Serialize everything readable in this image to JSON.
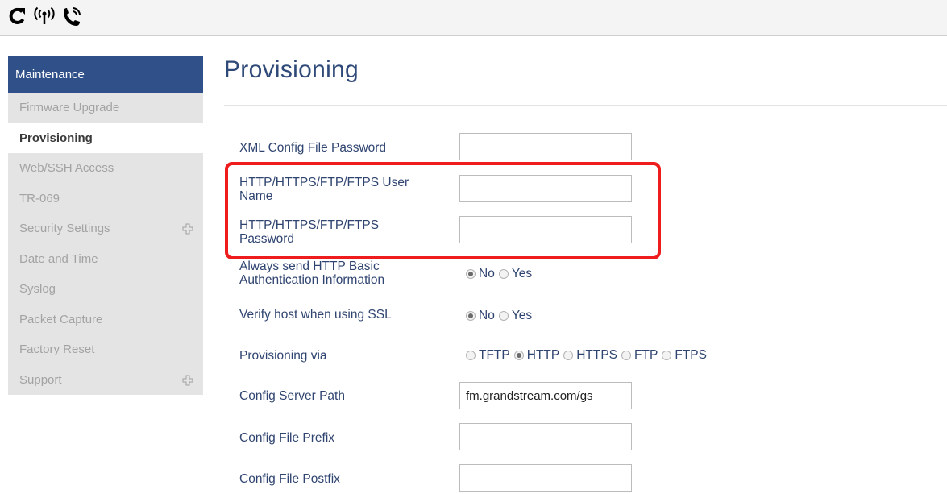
{
  "toolbar": {
    "icons": [
      "refresh-icon",
      "wireless-signal-icon",
      "phone-ringing-icon"
    ]
  },
  "sidebar": {
    "header": "Maintenance",
    "items": [
      {
        "label": "Firmware Upgrade",
        "active": false,
        "expandable": false
      },
      {
        "label": "Provisioning",
        "active": true,
        "expandable": false
      },
      {
        "label": "Web/SSH Access",
        "active": false,
        "expandable": false
      },
      {
        "label": "TR-069",
        "active": false,
        "expandable": false
      },
      {
        "label": "Security Settings",
        "active": false,
        "expandable": true
      },
      {
        "label": "Date and Time",
        "active": false,
        "expandable": false
      },
      {
        "label": "Syslog",
        "active": false,
        "expandable": false
      },
      {
        "label": "Packet Capture",
        "active": false,
        "expandable": false
      },
      {
        "label": "Factory Reset",
        "active": false,
        "expandable": false
      },
      {
        "label": "Support",
        "active": false,
        "expandable": true
      }
    ]
  },
  "page": {
    "title": "Provisioning"
  },
  "form": {
    "xml_password": {
      "label": "XML Config File Password",
      "value": ""
    },
    "http_username": {
      "label_line1": "HTTP/HTTPS/FTP/FTPS User",
      "label_line2": "Name",
      "value": ""
    },
    "http_password": {
      "label_line1": "HTTP/HTTPS/FTP/FTPS",
      "label_line2": "Password",
      "value": ""
    },
    "basic_auth": {
      "label_line1": "Always send HTTP Basic",
      "label_line2": "Authentication Information",
      "options": [
        "No",
        "Yes"
      ],
      "selected": "No"
    },
    "verify_ssl": {
      "label": "Verify host when using SSL",
      "options": [
        "No",
        "Yes"
      ],
      "selected": "No"
    },
    "provisioning_via": {
      "label": "Provisioning via",
      "options": [
        "TFTP",
        "HTTP",
        "HTTPS",
        "FTP",
        "FTPS"
      ],
      "selected": "HTTP"
    },
    "config_server_path": {
      "label": "Config Server Path",
      "value": "fm.grandstream.com/gs"
    },
    "config_file_prefix": {
      "label": "Config File Prefix",
      "value": ""
    },
    "config_file_postfix": {
      "label": "Config File Postfix",
      "value": ""
    }
  },
  "colors": {
    "sidebar_header_bg": "#2f5089",
    "sidebar_item_bg": "#e4e4e4",
    "title_color": "#2f4a78",
    "highlight_border": "#ee1c1c"
  }
}
